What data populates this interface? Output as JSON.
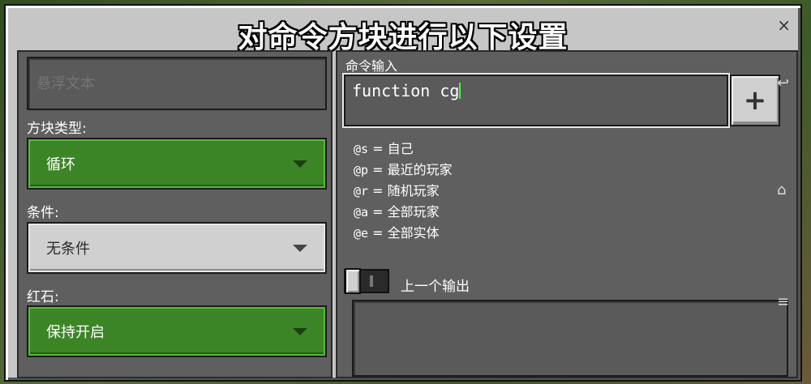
{
  "dialog": {
    "title": "对命令方块进行以下设置",
    "close_icon": "×"
  },
  "left_panel": {
    "hover_text_placeholder": "悬浮文本",
    "block_type": {
      "label": "方块类型:",
      "value": "循环"
    },
    "condition": {
      "label": "条件:",
      "value": "无条件"
    },
    "redstone": {
      "label": "红石:",
      "value": "保持开启"
    }
  },
  "right_panel": {
    "command_label": "命令输入",
    "command_value": "function cg",
    "add_button": "+",
    "selectors": [
      {
        "code": "@s",
        "eq": "=",
        "desc": "自己"
      },
      {
        "code": "@p",
        "eq": "=",
        "desc": "最近的玩家"
      },
      {
        "code": "@r",
        "eq": "=",
        "desc": "随机玩家"
      },
      {
        "code": "@a",
        "eq": "=",
        "desc": "全部玩家"
      },
      {
        "code": "@e",
        "eq": "=",
        "desc": "全部实体"
      }
    ],
    "previous_output_label": "上一个输出"
  },
  "colors": {
    "accent_green": "#3c8527",
    "panel_gray": "#5f5f5f",
    "frame_gray": "#c6c6c6"
  }
}
